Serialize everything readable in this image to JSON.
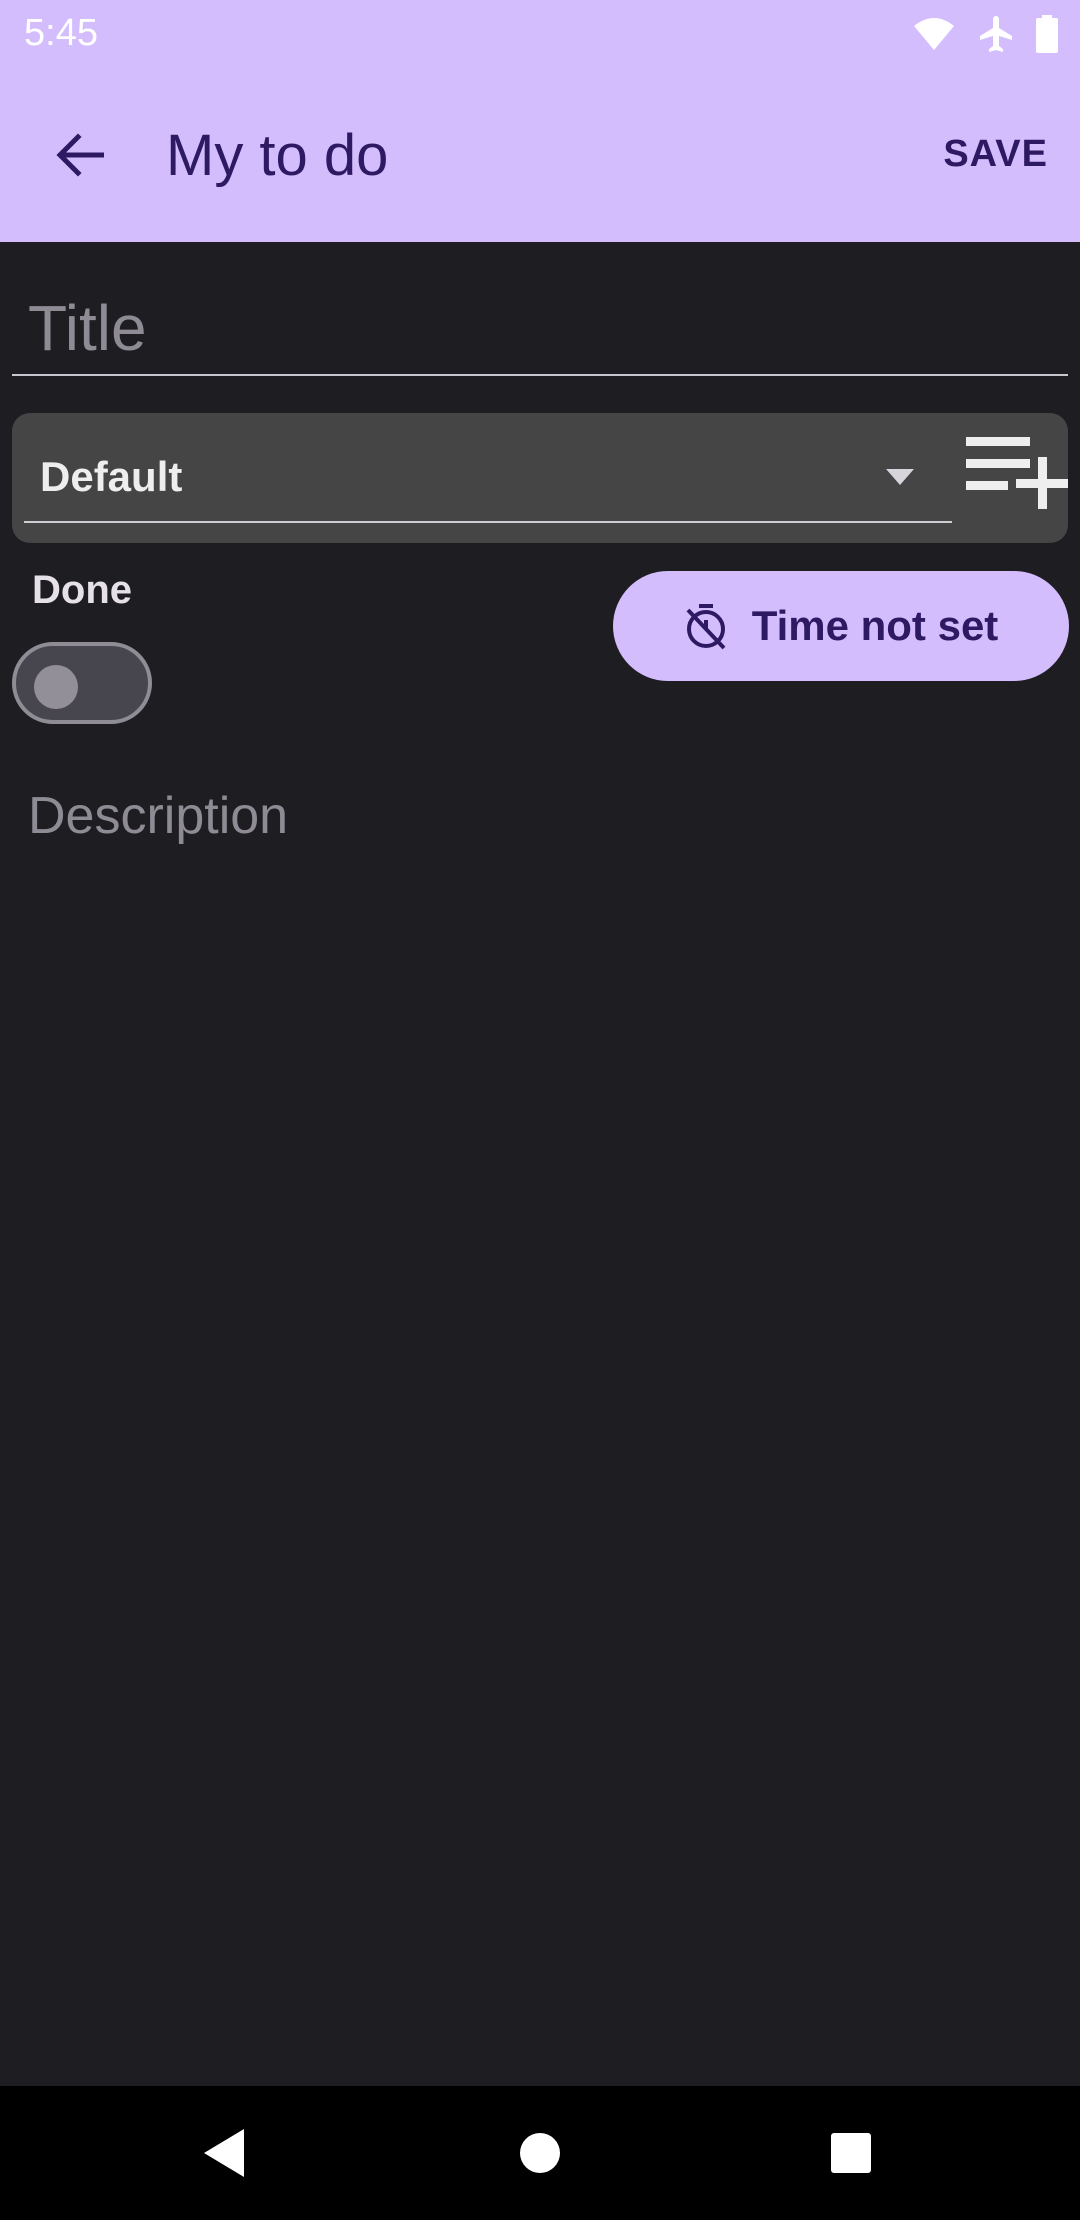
{
  "status_bar": {
    "time": "5:45",
    "icons": [
      "wifi-icon",
      "airplane-icon",
      "battery-icon"
    ]
  },
  "app_bar": {
    "title": "My to do",
    "save_label": "SAVE",
    "back_icon": "arrow-left-icon"
  },
  "form": {
    "title_placeholder": "Title",
    "category_selected": "Default",
    "add_category_icon": "playlist-add-icon",
    "done_label": "Done",
    "done_checked": false,
    "time_button_label": "Time not set",
    "time_icon": "timer-off-icon",
    "description_placeholder": "Description"
  },
  "nav_bar": {
    "buttons": [
      "back-triangle-icon",
      "home-circle-icon",
      "recents-square-icon"
    ]
  },
  "colors": {
    "accent": "#d3bdfd",
    "on_accent": "#2e1a62",
    "background": "#1e1d22",
    "surface": "#454545"
  }
}
